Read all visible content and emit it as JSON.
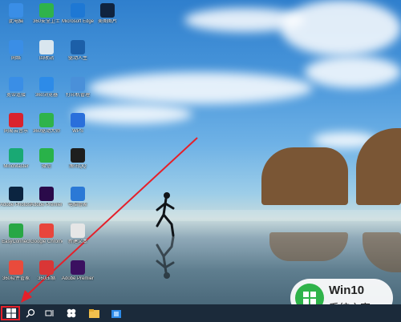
{
  "desktop": {
    "icons": [
      {
        "label": "此电脑",
        "icon": "computer-icon",
        "color": "#3a8ee6"
      },
      {
        "label": "360安全卫士",
        "icon": "shield-icon",
        "color": "#2fb34a"
      },
      {
        "label": "Microsoft Edge",
        "icon": "edge-icon",
        "color": "#1e78d4"
      },
      {
        "label": "美图图片",
        "icon": "ps-icon",
        "color": "#10243f"
      },
      {
        "label": "网络",
        "icon": "network-icon",
        "color": "#3a8ee6"
      },
      {
        "label": "回收站",
        "icon": "recycle-bin-icon",
        "color": "#d9e6ef"
      },
      {
        "label": "驱动人生",
        "icon": "driver-icon",
        "color": "#1c5fa8"
      },
      {
        "label": "宽带连接",
        "icon": "broadband-icon",
        "color": "#3a8ee6"
      },
      {
        "label": "360浏览器",
        "icon": "browser-360-icon",
        "color": "#2d8be8"
      },
      {
        "label": "打印机管理",
        "icon": "printer-icon",
        "color": "#4a90d9"
      },
      {
        "label": "网易云音乐",
        "icon": "music-icon",
        "color": "#d9232e"
      },
      {
        "label": "360驱动大师",
        "icon": "driver-master-icon",
        "color": "#2fb34a"
      },
      {
        "label": "WPS",
        "icon": "wps-icon",
        "color": "#2a6fdb"
      },
      {
        "label": "MindMaster",
        "icon": "mindmaster-icon",
        "color": "#19a974"
      },
      {
        "label": "微信",
        "icon": "wechat-icon",
        "color": "#29b249"
      },
      {
        "label": "腾讯QQ",
        "icon": "qq-icon",
        "color": "#1e1e1e"
      },
      {
        "label": "Adobe Photosh...",
        "icon": "photoshop-icon",
        "color": "#0b2440"
      },
      {
        "label": "Adobe Premier...",
        "icon": "premiere-icon",
        "color": "#2a0a4a"
      },
      {
        "label": "电脑管家",
        "icon": "pc-manager-icon",
        "color": "#2b79d6"
      },
      {
        "label": "EasyConnect",
        "icon": "easyconnect-icon",
        "color": "#28a745"
      },
      {
        "label": "Google Chrome",
        "icon": "chrome-icon",
        "color": "#e8453c"
      },
      {
        "label": "新建文本",
        "icon": "text-file-icon",
        "color": "#e6e6e6"
      },
      {
        "label": "360软件管家",
        "icon": "software-manager-icon",
        "color": "#e94b3c"
      },
      {
        "label": "360压缩",
        "icon": "zip-icon",
        "color": "#d93636"
      },
      {
        "label": "Adobe Premiere...",
        "icon": "premiere-file-icon",
        "color": "#3b1060"
      }
    ]
  },
  "taskbar": {
    "items": [
      "start-icon",
      "search-icon",
      "task-view-icon",
      "app-icon",
      "file-explorer-icon",
      "store-icon"
    ]
  },
  "watermark": {
    "title": "Win10",
    "subtitle": "系统之家"
  }
}
